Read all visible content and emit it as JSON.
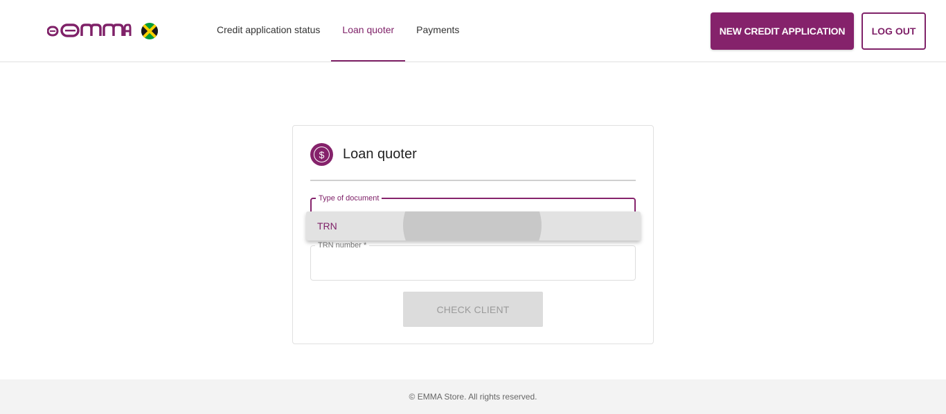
{
  "brand": {
    "name": "emma",
    "accent_color": "#85226b",
    "flag": "jamaica-flag-icon"
  },
  "nav": {
    "items": [
      {
        "label": "Credit application status",
        "active": false
      },
      {
        "label": "Loan quoter",
        "active": true
      },
      {
        "label": "Payments",
        "active": false
      }
    ]
  },
  "header": {
    "new_application_label": "NEW CREDIT APPLICATION",
    "logout_label": "LOG OUT"
  },
  "card": {
    "icon": "dollar-circle-icon",
    "title": "Loan quoter",
    "document_type_label": "Type of document",
    "trn_label": "TRN number *",
    "check_button_label": "CHECK CLIENT"
  },
  "dropdown": {
    "options": [
      "TRN"
    ]
  },
  "footer": {
    "text": "© EMMA Store. All rights reserved."
  }
}
